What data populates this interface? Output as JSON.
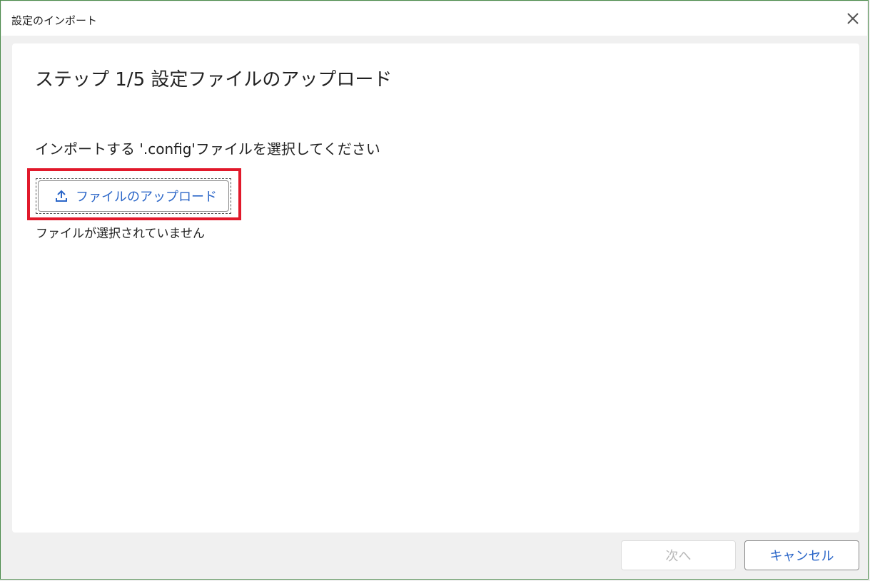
{
  "dialog": {
    "title": "設定のインポート",
    "close_icon": "close-icon"
  },
  "main": {
    "step_heading": "ステップ 1/5 設定ファイルのアップロード",
    "instruction": "インポートする '.config'ファイルを選択してください",
    "upload_button_label": "ファイルのアップロード",
    "upload_icon": "upload-icon",
    "no_file_text": "ファイルが選択されていません"
  },
  "footer": {
    "next_label": "次へ",
    "cancel_label": "キャンセル"
  },
  "colors": {
    "accent": "#2b66c8",
    "highlight": "#e1192b",
    "disabled": "#b8b8b8"
  }
}
